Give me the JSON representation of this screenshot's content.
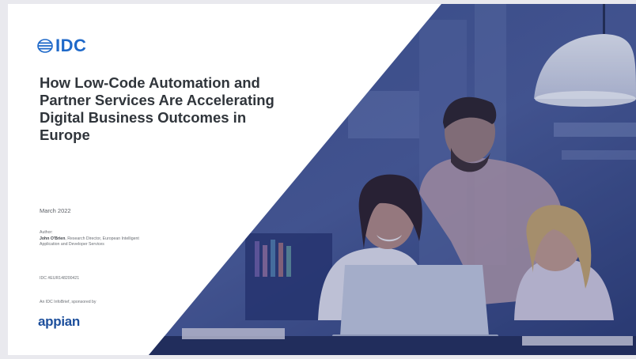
{
  "logo": {
    "text": "IDC"
  },
  "title": "How Low-Code Automation and Partner Services Are Accelerating Digital Business Outcomes in Europe",
  "date": "March 2022",
  "author": {
    "label": "Author:",
    "name": "John O'Brien",
    "role": ", Research Director, European Intelligent Application and Developer Services"
  },
  "doc_id": "IDC #EUR148200421",
  "sponsor_text": "An IDC InfoBrief, sponsored by",
  "sponsor_logo": "appian",
  "colors": {
    "idc_blue": "#1f69c9",
    "appian_blue": "#1d4f9c",
    "title_dark": "#30353b",
    "overlay_navy": "#263a78"
  }
}
